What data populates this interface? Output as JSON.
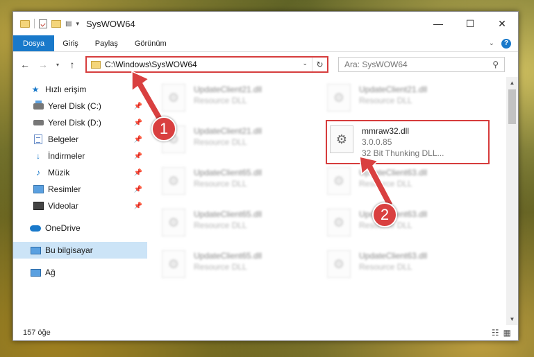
{
  "window": {
    "title": "SysWOW64"
  },
  "menubar": {
    "file": "Dosya",
    "home": "Giriş",
    "share": "Paylaş",
    "view": "Görünüm"
  },
  "address": {
    "path": "C:\\Windows\\SysWOW64"
  },
  "search": {
    "placeholder": "Ara: SysWOW64"
  },
  "sidebar": {
    "items": [
      {
        "label": "Hızlı erişim"
      },
      {
        "label": "Yerel Disk (C:)"
      },
      {
        "label": "Yerel Disk (D:)"
      },
      {
        "label": "Belgeler"
      },
      {
        "label": "İndirmeler"
      },
      {
        "label": "Müzik"
      },
      {
        "label": "Resimler"
      },
      {
        "label": "Videolar"
      },
      {
        "label": "OneDrive"
      },
      {
        "label": "Bu bilgisayar"
      },
      {
        "label": "Ağ"
      }
    ]
  },
  "files": [
    {
      "name": "UpdateClient21.dll",
      "sub": "Resource DLL"
    },
    {
      "name": "UpdateClient21.dll",
      "sub": "Resource DLL"
    },
    {
      "name": "UpdateClient21.dll",
      "sub": "Resource DLL"
    },
    {
      "name": "mmraw32.dll",
      "version": "3.0.0.85",
      "description": "32 Bit Thunking DLL..."
    },
    {
      "name": "UpdateClient65.dll",
      "sub": "Resource DLL"
    },
    {
      "name": "UpdateClient63.dll",
      "sub": "Resource DLL"
    },
    {
      "name": "UpdateClient65.dll",
      "sub": "Resource DLL"
    },
    {
      "name": "UpdateClient63.dll",
      "sub": "Resource DLL"
    },
    {
      "name": "UpdateClient65.dll",
      "sub": "Resource DLL"
    },
    {
      "name": "UpdateClient63.dll",
      "sub": "Resource DLL"
    }
  ],
  "status": {
    "count": "157 öğe"
  },
  "callouts": {
    "one": "1",
    "two": "2"
  },
  "colors": {
    "accent": "#1979ca",
    "highlight": "#d63c3c",
    "selected": "#cce4f7"
  }
}
